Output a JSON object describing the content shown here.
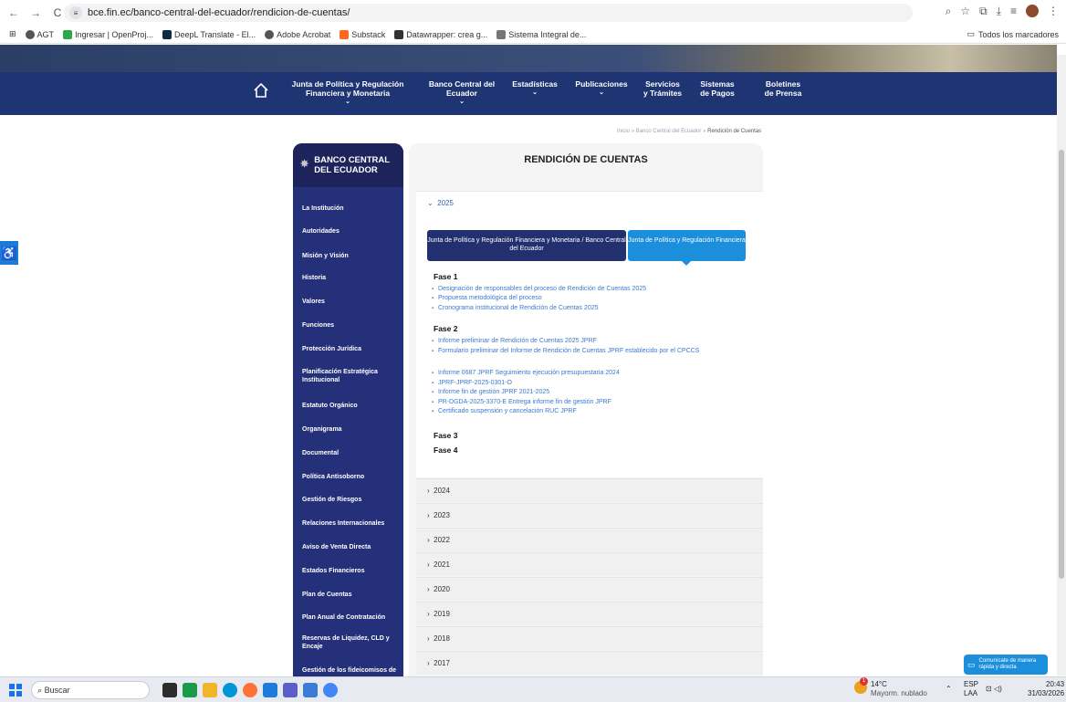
{
  "browser": {
    "url": "bce.fin.ec/banco-central-del-ecuador/rendicion-de-cuentas/",
    "bookmarks": [
      "AGT",
      "Ingresar | OpenProj...",
      "DeepL Translate - El...",
      "Adobe Acrobat",
      "Substack",
      "Datawrapper: crea g...",
      "Sistema Integral de..."
    ],
    "all_bookmarks": "Todos los marcadores"
  },
  "nav": {
    "junta": "Junta de Política y Regulación Financiera y Monetaria",
    "banco": "Banco Central del Ecuador",
    "estadisticas": "Estadísticas",
    "publicaciones": "Publicaciones",
    "servicios": "Servicios y Trámites",
    "sistemas": "Sistemas de Pagos",
    "boletines": "Boletines de Prensa"
  },
  "breadcrumb": {
    "inicio": "Inicio",
    "sep": "»",
    "banco": "Banco Central del Ecuador",
    "current": "Rendición de Cuentas"
  },
  "sidebar": {
    "title": "BANCO CENTRAL DEL ECUADOR",
    "items": [
      "La Institución",
      "Autoridades",
      "Misión y Visión",
      "Historia",
      "Valores",
      "Funciones",
      "Protección Jurídica",
      "Planificación Estratégica Institucional",
      "Estatuto Orgánico",
      "Organigrama",
      "Documental",
      "Política Antisoborno",
      "Gestión de Riesgos",
      "Relaciones Internacionales",
      "Aviso de Venta Directa",
      "Estados Financieros",
      "Plan de Cuentas",
      "Plan Anual de Contratación",
      "Reservas de Liquidez, CLD y Encaje",
      "Gestión de los fideicomisos de"
    ]
  },
  "main": {
    "title": "RENDICIÓN DE CUENTAS",
    "open_year": "2025",
    "tab1": "Junta de Política y Regulación Financiera y Monetaria / Banco Central del Ecuador",
    "tab2": "Junta de Política y Regulación Financiera",
    "fase1": "Fase 1",
    "fase1_links": [
      "Designación de responsables del proceso de Rendición de Cuentas 2025",
      "Propuesta metodológica del proceso",
      "Cronograma institucional de Rendición de Cuentas 2025"
    ],
    "fase2": "Fase 2",
    "fase2_links": [
      "Informe preliminar de Rendición de Cuentas 2025 JPRF",
      "Formulario preliminar del Informe de Rendición de Cuentas JPRF establecido por el CPCCS",
      "Informe 0687 JPRF Seguimiento ejecución presupuestaria 2024",
      "JPRF-JPRF-2025-0301-O",
      "Informe fin de gestión JPRF 2021-2025",
      "PR-DGDA-2025-3370-E Entrega informe fin de gestión JPRF",
      "Certificado suspensión y cancelación RUC JPRF"
    ],
    "fase3": "Fase 3",
    "fase4": "Fase 4",
    "years": [
      "2024",
      "2023",
      "2022",
      "2021",
      "2020",
      "2019",
      "2018",
      "2017"
    ]
  },
  "chat": "Comunícate de manera rápida y directa",
  "taskbar": {
    "search": "Buscar",
    "weather_temp": "14°C",
    "weather_desc": "Mayorm. nublado",
    "lang": "ESP",
    "lang2": "LAA",
    "time": "20:43",
    "date": "31/03/2026",
    "badge": "1"
  }
}
